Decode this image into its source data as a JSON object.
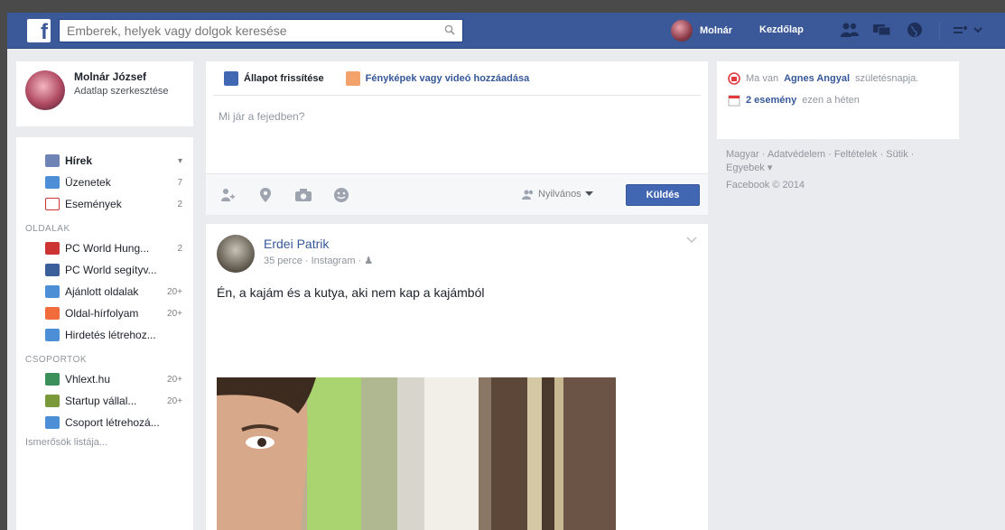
{
  "topbar": {
    "logo": "f",
    "search_placeholder": "Emberek, helyek vagy dolgok keresése",
    "user_name": "Molnár",
    "home_label": "Kezdőlap"
  },
  "profile": {
    "name": "Molnár József",
    "edit_label": "Adatlap szerkesztése"
  },
  "nav": {
    "items": [
      {
        "label": "Hírek",
        "count": "",
        "icon": "news-feed-icon",
        "color": "#6d84b4"
      },
      {
        "label": "Üzenetek",
        "count": "7",
        "icon": "messages-icon",
        "color": "#4c8fd6"
      },
      {
        "label": "Események",
        "count": "2",
        "icon": "calendar-icon",
        "color": "#d9d9d9"
      }
    ],
    "pages_header": "OLDALAK",
    "pages": [
      {
        "label": "PC World Hung...",
        "count": "2",
        "color": "#c33"
      },
      {
        "label": "PC World segítyv...",
        "count": "",
        "color": "#3a5f9a"
      },
      {
        "label": "Ajánlott oldalak",
        "count": "20+",
        "color": "#4c8fd6"
      },
      {
        "label": "Oldal-hírfolyam",
        "count": "20+",
        "color": "#f26b3a"
      },
      {
        "label": "Hirdetés létrehoz...",
        "count": "",
        "color": "#4c8fd6"
      }
    ],
    "groups_header": "CSOPORTOK",
    "groups": [
      {
        "label": "Vhlext.hu",
        "count": "20+",
        "color": "#3b8f5a"
      },
      {
        "label": "Startup vállal...",
        "count": "20+",
        "color": "#7a9a3a"
      },
      {
        "label": "Csoport létrehozá...",
        "count": "",
        "color": "#4c8fd6"
      }
    ],
    "more": "Ismerősök listája..."
  },
  "composer": {
    "status_tab": "Állapot frissítése",
    "photo_tab": "Fényképek vagy videó hozzáadása",
    "placeholder": "Mi jár a fejedben?",
    "privacy": "Nyilvános",
    "post_button": "Küldés"
  },
  "post": {
    "author": "Erdei Patrik",
    "meta": "35 perce · Instagram · ",
    "text": "Én, a kajám és a kutya, aki nem kap a kajámból"
  },
  "right": {
    "birthday_prefix": "Ma van",
    "birthday_name": "Agnes Angyal",
    "birthday_suffix": "születésnapja.",
    "events_link": "2 esemény",
    "events_suffix": "ezen a héten",
    "footer_links": "Magyar · Adatvédelem · Feltételek · Sütik · Egyebek ▾",
    "copyright": "Facebook © 2014"
  },
  "colors": {
    "brand": "#3b5998",
    "link": "#365899",
    "button": "#4267b2"
  }
}
